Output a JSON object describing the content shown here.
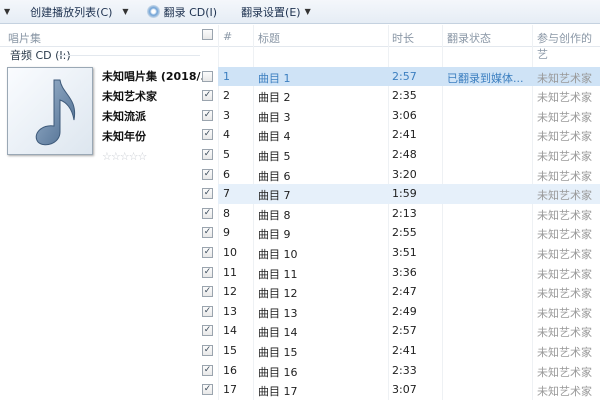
{
  "toolbar": {
    "create_playlist": "创建播放列表(C)",
    "rip_cd": "翻录 CD(I)",
    "rip_settings": "翻录设置(E)"
  },
  "left": {
    "header": "唱片集",
    "group": "音频 CD (I:)",
    "album": "未知唱片集 (2018/...",
    "artist": "未知艺术家",
    "genre": "未知流派",
    "year": "未知年份",
    "rating": 0
  },
  "columns": {
    "num": "#",
    "title": "标题",
    "duration": "时长",
    "rip_status": "翻录状态",
    "contributing_artist": "参与创作的艺"
  },
  "colors": {
    "selected_row": "#cfe3f6",
    "selected_text": "#3c7fc0"
  },
  "tracks": [
    {
      "num": "1",
      "title": "曲目 1",
      "duration": "2:57",
      "status": "已翻录到媒体...",
      "artist": "未知艺术家",
      "checked": false
    },
    {
      "num": "2",
      "title": "曲目 2",
      "duration": "2:35",
      "status": "",
      "artist": "未知艺术家",
      "checked": true
    },
    {
      "num": "3",
      "title": "曲目 3",
      "duration": "3:06",
      "status": "",
      "artist": "未知艺术家",
      "checked": true
    },
    {
      "num": "4",
      "title": "曲目 4",
      "duration": "2:41",
      "status": "",
      "artist": "未知艺术家",
      "checked": true
    },
    {
      "num": "5",
      "title": "曲目 5",
      "duration": "2:48",
      "status": "",
      "artist": "未知艺术家",
      "checked": true
    },
    {
      "num": "6",
      "title": "曲目 6",
      "duration": "3:20",
      "status": "",
      "artist": "未知艺术家",
      "checked": true
    },
    {
      "num": "7",
      "title": "曲目 7",
      "duration": "1:59",
      "status": "",
      "artist": "未知艺术家",
      "checked": true
    },
    {
      "num": "8",
      "title": "曲目 8",
      "duration": "2:13",
      "status": "",
      "artist": "未知艺术家",
      "checked": true
    },
    {
      "num": "9",
      "title": "曲目 9",
      "duration": "2:55",
      "status": "",
      "artist": "未知艺术家",
      "checked": true
    },
    {
      "num": "10",
      "title": "曲目 10",
      "duration": "3:51",
      "status": "",
      "artist": "未知艺术家",
      "checked": true
    },
    {
      "num": "11",
      "title": "曲目 11",
      "duration": "3:36",
      "status": "",
      "artist": "未知艺术家",
      "checked": true
    },
    {
      "num": "12",
      "title": "曲目 12",
      "duration": "2:47",
      "status": "",
      "artist": "未知艺术家",
      "checked": true
    },
    {
      "num": "13",
      "title": "曲目 13",
      "duration": "2:49",
      "status": "",
      "artist": "未知艺术家",
      "checked": true
    },
    {
      "num": "14",
      "title": "曲目 14",
      "duration": "2:57",
      "status": "",
      "artist": "未知艺术家",
      "checked": true
    },
    {
      "num": "15",
      "title": "曲目 15",
      "duration": "2:41",
      "status": "",
      "artist": "未知艺术家",
      "checked": true
    },
    {
      "num": "16",
      "title": "曲目 16",
      "duration": "2:33",
      "status": "",
      "artist": "未知艺术家",
      "checked": true
    },
    {
      "num": "17",
      "title": "曲目 17",
      "duration": "3:07",
      "status": "",
      "artist": "未知艺术家",
      "checked": true
    }
  ]
}
